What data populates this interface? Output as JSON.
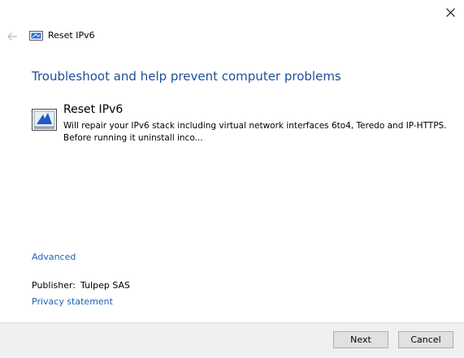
{
  "window": {
    "title": "Reset IPv6",
    "close_icon": "close-icon",
    "back_icon": "back-arrow-icon"
  },
  "main": {
    "heading": "Troubleshoot and help prevent computer problems",
    "item": {
      "icon": "troubleshooter-package-icon",
      "title": "Reset IPv6",
      "description": "Will repair your IPv6 stack including virtual network interfaces 6to4, Teredo and IP-HTTPS. Before running it uninstall inco..."
    },
    "advanced_link": "Advanced",
    "publisher": {
      "label": "Publisher:",
      "value": "Tulpep SAS"
    },
    "privacy_link": "Privacy statement"
  },
  "footer": {
    "next_label": "Next",
    "cancel_label": "Cancel"
  },
  "colors": {
    "heading": "#1b4f9c",
    "link": "#1a61b8",
    "footer_bg": "#f0f0f0",
    "button_bg": "#e1e1e1"
  }
}
